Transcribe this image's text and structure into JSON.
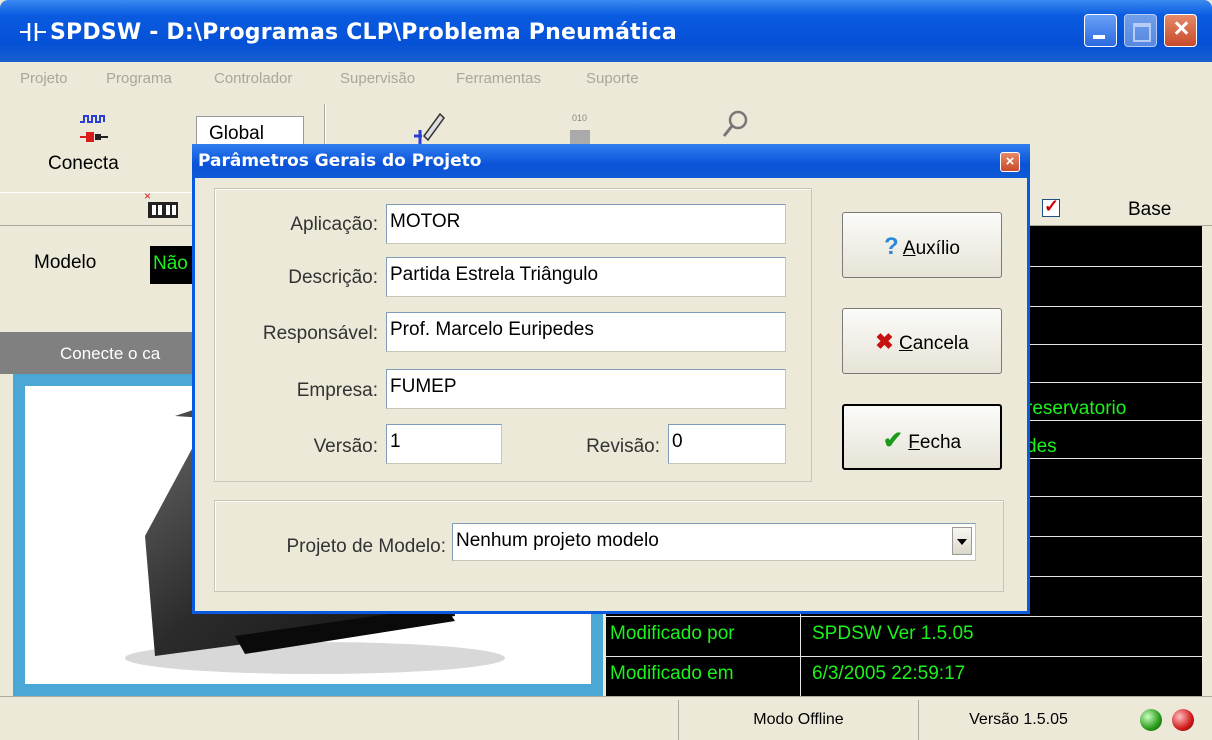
{
  "window": {
    "title": "SPDSW - D:\\Programas CLP\\Problema Pneumática"
  },
  "menu": [
    "Projeto",
    "Programa",
    "Controlador",
    "Supervisão",
    "Ferramentas",
    "Suporte"
  ],
  "toolbar": {
    "conecta_label": "Conecta",
    "global_value": "Global"
  },
  "left_panel": {
    "modelo_label": "Modelo",
    "modelo_value": "Não",
    "conecte_text": "Conecte o ca"
  },
  "right_panel": {
    "base_label": "Base",
    "rows": [
      {
        "key": "",
        "value": "reservatorio"
      },
      {
        "key": "",
        "value": "des"
      },
      {
        "key": "Modificado por",
        "value": "SPDSW Ver 1.5.05"
      },
      {
        "key": "Modificado em",
        "value": "6/3/2005 22:59:17"
      }
    ]
  },
  "status": {
    "mode": "Modo Offline",
    "version": "Versão 1.5.05"
  },
  "dialog": {
    "title": "Parâmetros Gerais do Projeto",
    "fields": {
      "aplicacao": {
        "label": "Aplicação:",
        "value": "MOTOR"
      },
      "descricao": {
        "label": "Descrição:",
        "value": "Partida Estrela Triângulo"
      },
      "responsavel": {
        "label": "Responsável:",
        "value": "Prof. Marcelo Euripedes"
      },
      "empresa": {
        "label": "Empresa:",
        "value": "FUMEP"
      },
      "versao": {
        "label": "Versão:",
        "value": "1"
      },
      "revisao": {
        "label": "Revisão:",
        "value": "0"
      }
    },
    "modelo": {
      "label": "Projeto de Modelo:",
      "value": "Nenhum projeto modelo"
    },
    "buttons": {
      "auxilio": {
        "mnemonic": "A",
        "rest": "uxílio"
      },
      "cancela": {
        "mnemonic": "C",
        "rest": "ancela"
      },
      "fecha": {
        "mnemonic": "F",
        "rest": "echa"
      }
    }
  }
}
